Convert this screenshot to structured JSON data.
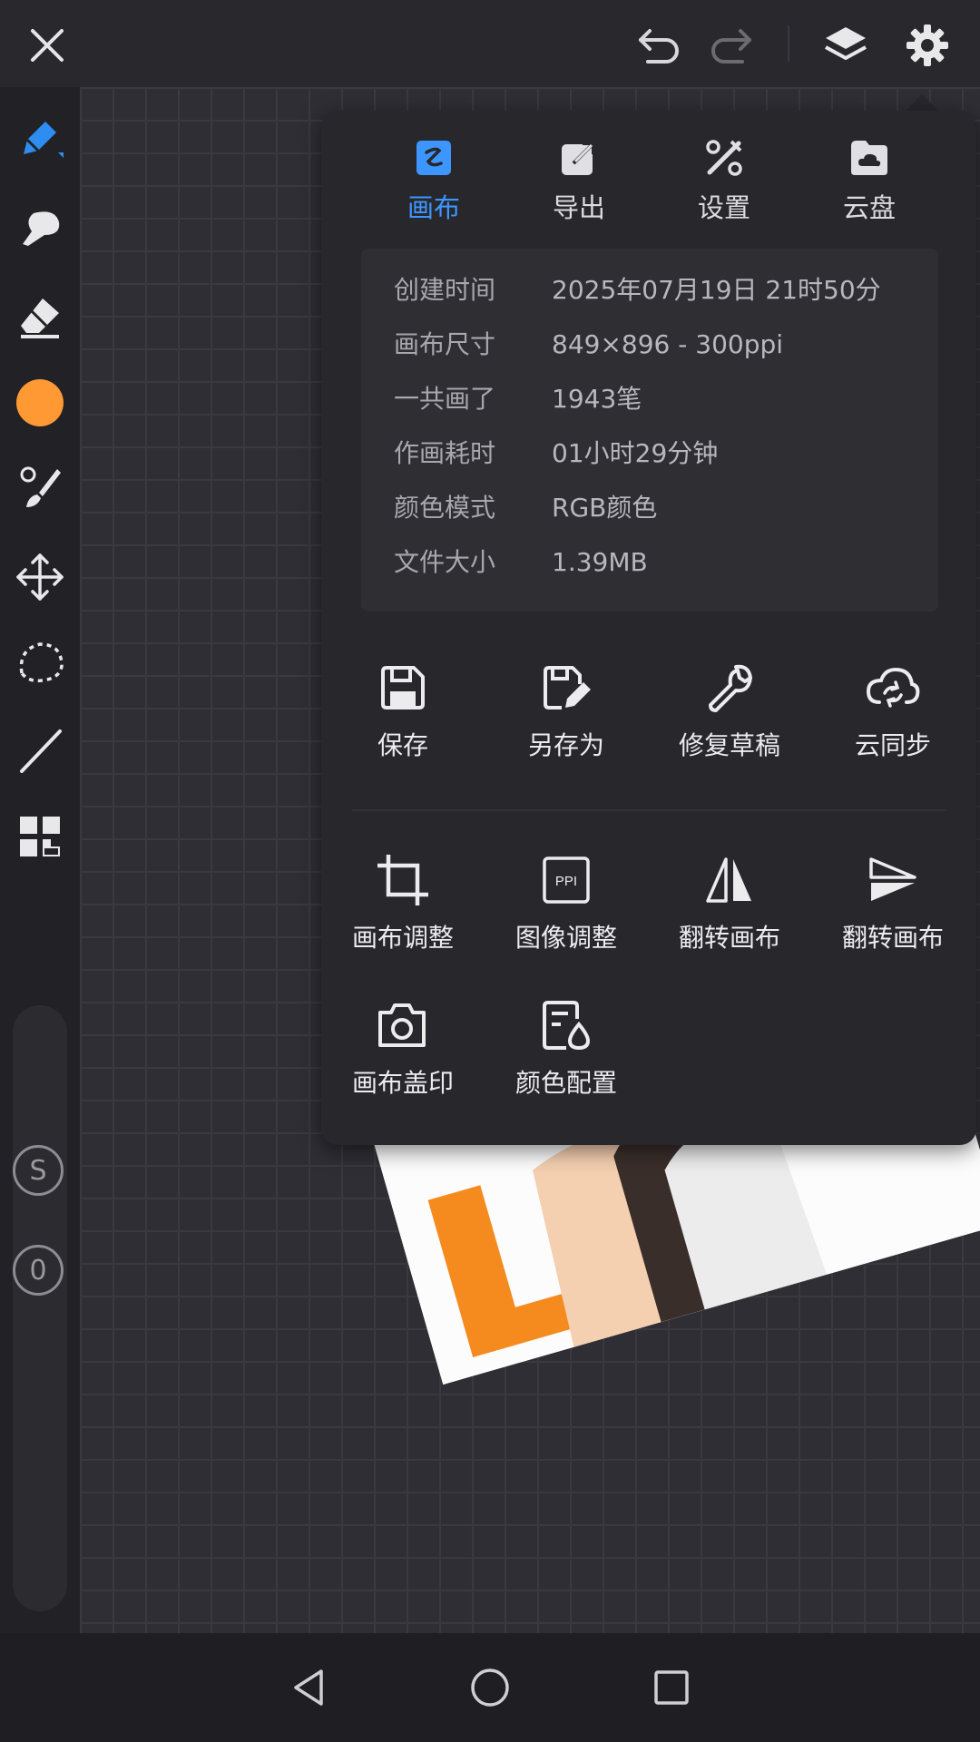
{
  "colors": {
    "accent": "#3d96ff",
    "brush_color": "#ff9933",
    "panel_bg": "#28272c"
  },
  "icons": {
    "topbar": [
      "close-icon",
      "undo-icon",
      "redo-icon",
      "layers-icon",
      "gear-icon"
    ],
    "leftbar": [
      "pen-icon",
      "smudge-icon",
      "eraser-icon",
      "color-swatch",
      "brush-picker-icon",
      "move-icon",
      "lasso-icon",
      "line-icon",
      "grid-icon"
    ]
  },
  "leftbar": {
    "s_label": "S",
    "zero_label": "0"
  },
  "tabs": [
    {
      "label": "画布",
      "active": true
    },
    {
      "label": "导出",
      "active": false
    },
    {
      "label": "设置",
      "active": false
    },
    {
      "label": "云盘",
      "active": false
    }
  ],
  "info": [
    {
      "key": "创建时间",
      "value": "2025年07月19日 21时50分"
    },
    {
      "key": "画布尺寸",
      "value": "849×896 - 300ppi"
    },
    {
      "key": "一共画了",
      "value": "1943笔"
    },
    {
      "key": "作画耗时",
      "value": "01小时29分钟"
    },
    {
      "key": "颜色模式",
      "value": "RGB颜色"
    },
    {
      "key": "文件大小",
      "value": "1.39MB"
    }
  ],
  "actions_row1": [
    {
      "label": "保存",
      "icon": "save-icon"
    },
    {
      "label": "另存为",
      "icon": "save-as-icon"
    },
    {
      "label": "修复草稿",
      "icon": "wrench-icon"
    },
    {
      "label": "云同步",
      "icon": "cloud-sync-icon"
    }
  ],
  "actions_row2": [
    {
      "label": "画布调整",
      "icon": "crop-icon"
    },
    {
      "label": "图像调整",
      "icon": "ppi-icon"
    },
    {
      "label": "翻转画布",
      "icon": "flip-horizontal-icon"
    },
    {
      "label": "翻转画布",
      "icon": "flip-vertical-icon"
    }
  ],
  "actions_row3": [
    {
      "label": "画布盖印",
      "icon": "camera-icon"
    },
    {
      "label": "颜色配置",
      "icon": "color-profile-icon"
    }
  ],
  "ppi_text": "PPI"
}
